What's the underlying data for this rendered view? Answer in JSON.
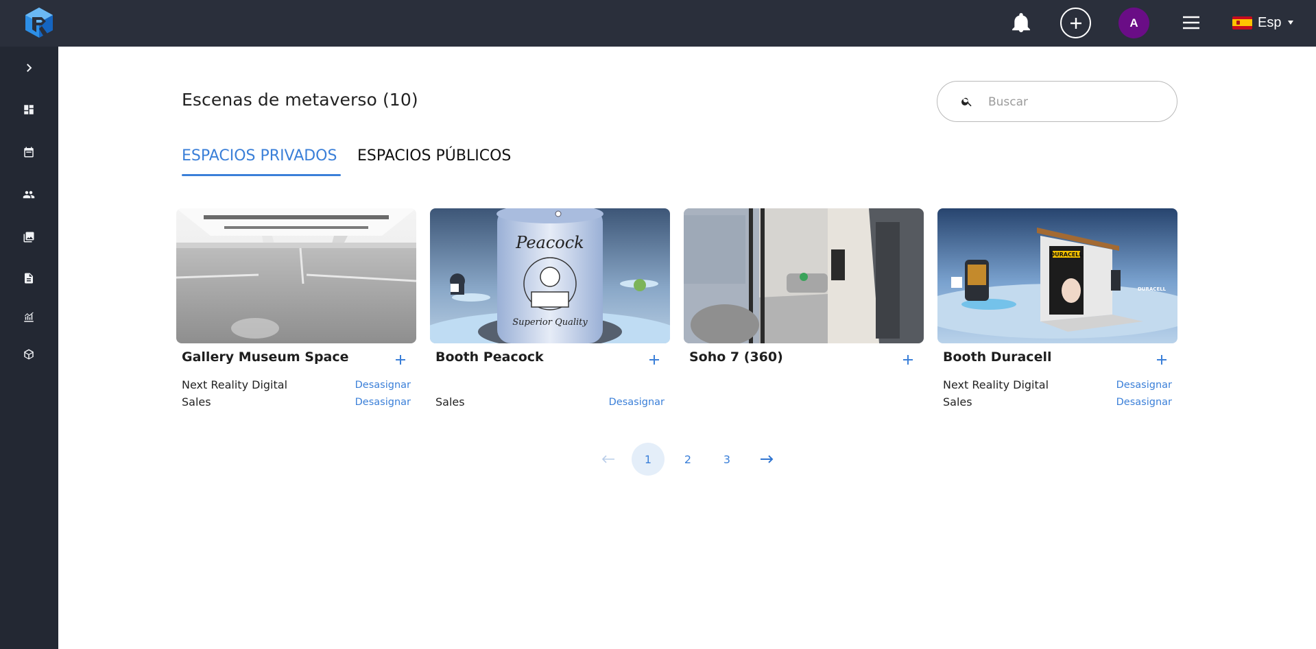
{
  "header": {
    "avatar_initial": "A",
    "language_label": "Esp"
  },
  "page": {
    "title": "Escenas de metaverso (10)",
    "search_placeholder": "Buscar"
  },
  "tabs": [
    {
      "label": "ESPACIOS PRIVADOS",
      "active": true
    },
    {
      "label": "ESPACIOS PÚBLICOS",
      "active": false
    }
  ],
  "cards": [
    {
      "title": "Gallery Museum Space",
      "assignments": [
        {
          "name": "Next Reality Digital",
          "action": "Desasignar"
        },
        {
          "name": "Sales",
          "action": "Desasignar"
        }
      ]
    },
    {
      "title": "Booth Peacock",
      "assignments": [
        {
          "name": "",
          "action": ""
        },
        {
          "name": "Sales",
          "action": "Desasignar"
        }
      ]
    },
    {
      "title": "Soho 7 (360)",
      "assignments": []
    },
    {
      "title": "Booth Duracell",
      "assignments": [
        {
          "name": "Next Reality Digital",
          "action": "Desasignar"
        },
        {
          "name": "Sales",
          "action": "Desasignar"
        }
      ]
    }
  ],
  "pagination": {
    "pages": [
      "1",
      "2",
      "3"
    ],
    "current": "1"
  },
  "colors": {
    "topbar": "#2a2f3b",
    "sidebar": "#232833",
    "accent": "#3a7fd8",
    "avatar": "#6a0d86"
  }
}
